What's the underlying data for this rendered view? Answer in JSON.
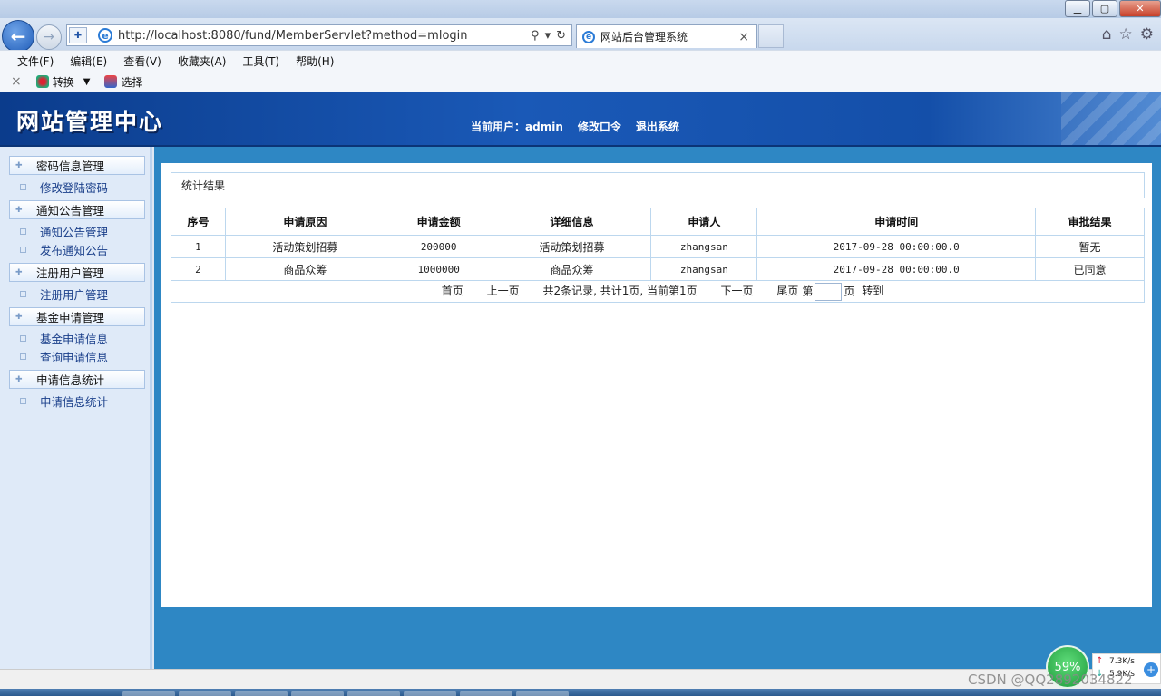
{
  "browser": {
    "address": {
      "url": "http://localhost:8080/fund/MemberServlet?method=mlogin"
    },
    "tab": {
      "title": "网站后台管理系统",
      "close": "×"
    },
    "menu": [
      "文件(F)",
      "编辑(E)",
      "查看(V)",
      "收藏夹(A)",
      "工具(T)",
      "帮助(H)"
    ],
    "toolbar": {
      "close": "×",
      "convert": "转换",
      "select": "选择"
    }
  },
  "header": {
    "logo": "网站管理中心",
    "current_user_label": "当前用户：",
    "current_user": "admin",
    "change_password": "修改口令",
    "logout": "退出系统"
  },
  "sidebar": {
    "groups": [
      {
        "title": "密码信息管理",
        "items": [
          "修改登陆密码"
        ]
      },
      {
        "title": "通知公告管理",
        "items": [
          "通知公告管理",
          "发布通知公告"
        ]
      },
      {
        "title": "注册用户管理",
        "items": [
          "注册用户管理"
        ]
      },
      {
        "title": "基金申请管理",
        "items": [
          "基金申请信息",
          "查询申请信息"
        ]
      },
      {
        "title": "申请信息统计",
        "items": [
          "申请信息统计"
        ]
      }
    ]
  },
  "main": {
    "panel_title": "统计结果",
    "table": {
      "headers": [
        "序号",
        "申请原因",
        "申请金额",
        "详细信息",
        "申请人",
        "申请时间",
        "审批结果"
      ],
      "rows": [
        [
          "1",
          "活动策划招募",
          "200000",
          "活动策划招募",
          "zhangsan",
          "2017-09-28 00:00:00.0",
          "暂无"
        ],
        [
          "2",
          "商品众筹",
          "1000000",
          "商品众筹",
          "zhangsan",
          "2017-09-28 00:00:00.0",
          "已同意"
        ]
      ]
    },
    "pager": {
      "first": "首页",
      "prev": "上一页",
      "summary": "共2条记录, 共计1页, 当前第1页",
      "next": "下一页",
      "last": "尾页",
      "page_prefix": "第",
      "page_suffix": "页",
      "go": "转到"
    }
  },
  "tray": {
    "percent": "59%",
    "up_speed": "7.3K/s",
    "down_speed": "5.9K/s"
  },
  "watermark": "CSDN @QQ2892034822",
  "colors": {
    "header_blue": "#1a59b7",
    "content_blue": "#2e87c4",
    "sidebar_bg": "#dfeaf8"
  }
}
